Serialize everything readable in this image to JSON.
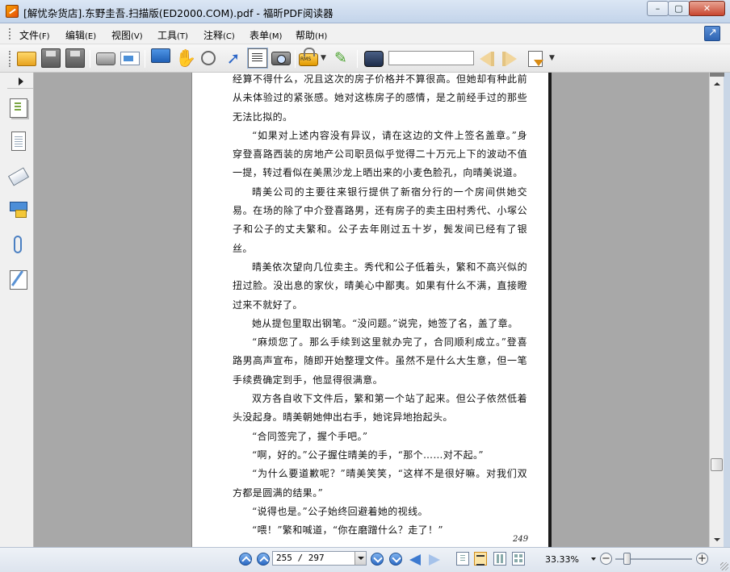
{
  "window": {
    "title": "[解忧杂货店].东野圭吾.扫描版(ED2000.COM).pdf - 福昕PDF阅读器",
    "minimize_label": "–",
    "maximize_label": "▢",
    "close_label": "✕"
  },
  "menu": {
    "items": [
      {
        "label": "文件",
        "accel": "(F)"
      },
      {
        "label": "编辑",
        "accel": "(E)"
      },
      {
        "label": "视图",
        "accel": "(V)"
      },
      {
        "label": "工具",
        "accel": "(T)"
      },
      {
        "label": "注释",
        "accel": "(C)"
      },
      {
        "label": "表单",
        "accel": "(M)"
      },
      {
        "label": "帮助",
        "accel": "(H)"
      }
    ]
  },
  "toolbar": {
    "rms_label": "RMS",
    "search_value": ""
  },
  "document": {
    "paragraphs": [
      {
        "indent": false,
        "text": "经算不得什么，况且这次的房子价格并不算很高。但她却有种此前从未体验过的紧张感。她对这栋房子的感情，是之前经手过的那些无法比拟的。"
      },
      {
        "indent": true,
        "text": "“如果对上述内容没有异议，请在这边的文件上签名盖章。”身穿登喜路西装的房地产公司职员似乎觉得二十万元上下的波动不值一提，转过看似在美黑沙龙上晒出来的小麦色脸孔，向晴美说道。"
      },
      {
        "indent": true,
        "text": "晴美公司的主要往来银行提供了新宿分行的一个房间供她交易。在场的除了中介登喜路男，还有房子的卖主田村秀代、小塚公子和公子的丈夫繁和。公子去年刚过五十岁，鬓发间已经有了银丝。"
      },
      {
        "indent": true,
        "text": "晴美依次望向几位卖主。秀代和公子低着头，繁和不高兴似的扭过脸。没出息的家伙，晴美心中鄙夷。如果有什么不满，直接瞪过来不就好了。"
      },
      {
        "indent": true,
        "text": "她从提包里取出钢笔。“没问题。”说完，她签了名，盖了章。"
      },
      {
        "indent": true,
        "text": "“麻烦您了。那么手续到这里就办完了，合同顺利成立。”登喜路男高声宣布，随即开始整理文件。虽然不是什么大生意，但一笔手续费确定到手，他显得很满意。"
      },
      {
        "indent": true,
        "text": "双方各自收下文件后，繁和第一个站了起来。但公子依然低着头没起身。晴美朝她伸出右手，她诧异地抬起头。"
      },
      {
        "indent": true,
        "text": "“合同签完了，握个手吧。”"
      },
      {
        "indent": true,
        "text": "“啊，好的。”公子握住晴美的手，“那个……对不起。”"
      },
      {
        "indent": true,
        "text": "“为什么要道歉呢？”晴美笑笑，“这样不是很好嘛。对我们双方都是圆满的结果。”"
      },
      {
        "indent": true,
        "text": "“说得也是。”公子始终回避着她的视线。"
      },
      {
        "indent": true,
        "text": "“喂！”繁和喊道，“你在磨蹭什么？走了！”"
      }
    ],
    "page_number": "249"
  },
  "status": {
    "page_field": "255 / 297",
    "zoom": "33.33%",
    "zoom_level_fraction": 0.12,
    "minus": "−",
    "plus": "+"
  }
}
